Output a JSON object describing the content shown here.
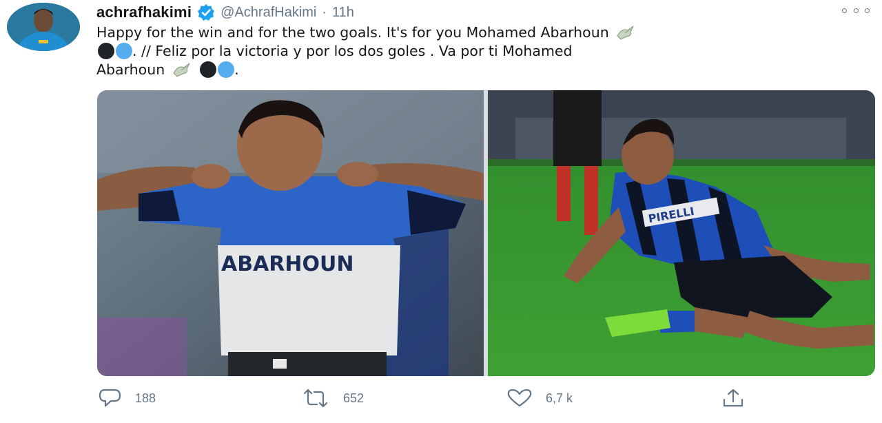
{
  "tweet": {
    "display_name": "achrafhakimi",
    "handle": "@AchrafHakimi",
    "separator": "·",
    "time": "11h",
    "text_line1": "Happy for the win and for the two goals. It's for you Mohamed Abarhoun",
    "text_line2a": ". //  Feliz por la victoria y por los dos goles . Va por ti Mohamed",
    "text_line3a": "Abarhoun",
    "text_line3b": ".",
    "shirt_text": "ABARHOUN",
    "sponsor_text": "PIRELLI"
  },
  "actions": {
    "reply_count": "188",
    "retweet_count": "652",
    "like_count": "6,7 k"
  },
  "colors": {
    "heart_black": "#202428",
    "heart_blue": "#55acee",
    "verified": "#1da1f2",
    "muted": "#657786"
  },
  "icons": {
    "verified": "verified-badge-icon",
    "more": "more-options-icon",
    "reply": "reply-icon",
    "retweet": "retweet-icon",
    "like": "like-icon",
    "share": "share-icon",
    "dove": "dove-emoji-icon"
  }
}
